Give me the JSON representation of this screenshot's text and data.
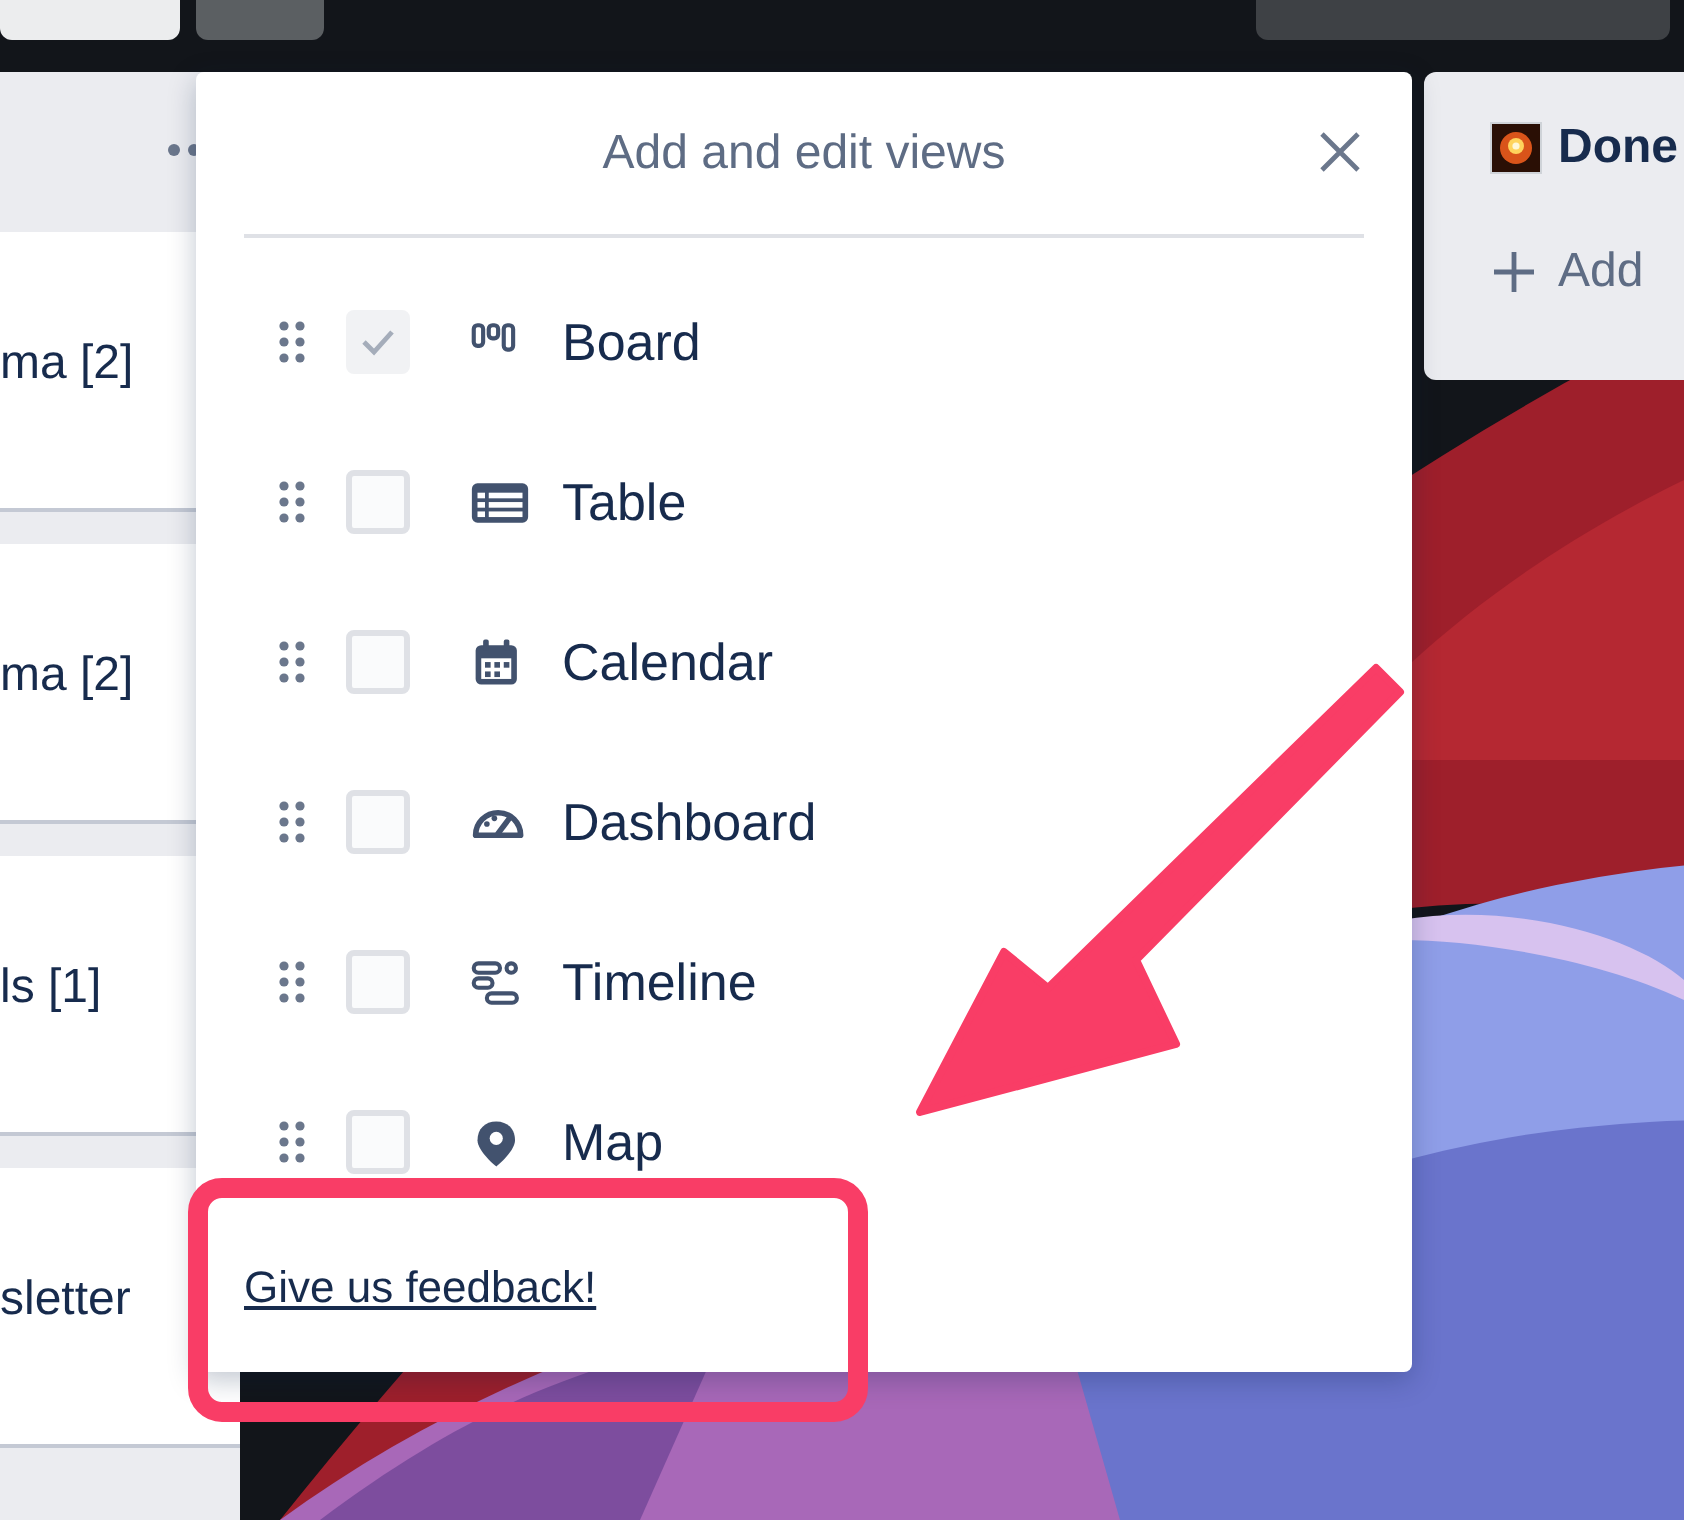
{
  "left_list": {
    "cards": [
      {
        "title": "ma [2]"
      },
      {
        "title": "ma [2]"
      },
      {
        "title": "ls [1]"
      },
      {
        "title": "sletter"
      }
    ]
  },
  "dialog": {
    "title": "Add and edit views",
    "views": [
      {
        "kind": "board",
        "label": "Board",
        "checked": true,
        "disabled": true
      },
      {
        "kind": "table",
        "label": "Table",
        "checked": false,
        "disabled": false
      },
      {
        "kind": "calendar",
        "label": "Calendar",
        "checked": false,
        "disabled": false
      },
      {
        "kind": "dashboard",
        "label": "Dashboard",
        "checked": false,
        "disabled": false
      },
      {
        "kind": "timeline",
        "label": "Timeline",
        "checked": false,
        "disabled": false
      },
      {
        "kind": "map",
        "label": "Map",
        "checked": false,
        "disabled": false
      }
    ],
    "feedback_link": "Give us feedback!"
  },
  "right_list": {
    "title": "Done",
    "add_label": "Add"
  }
}
